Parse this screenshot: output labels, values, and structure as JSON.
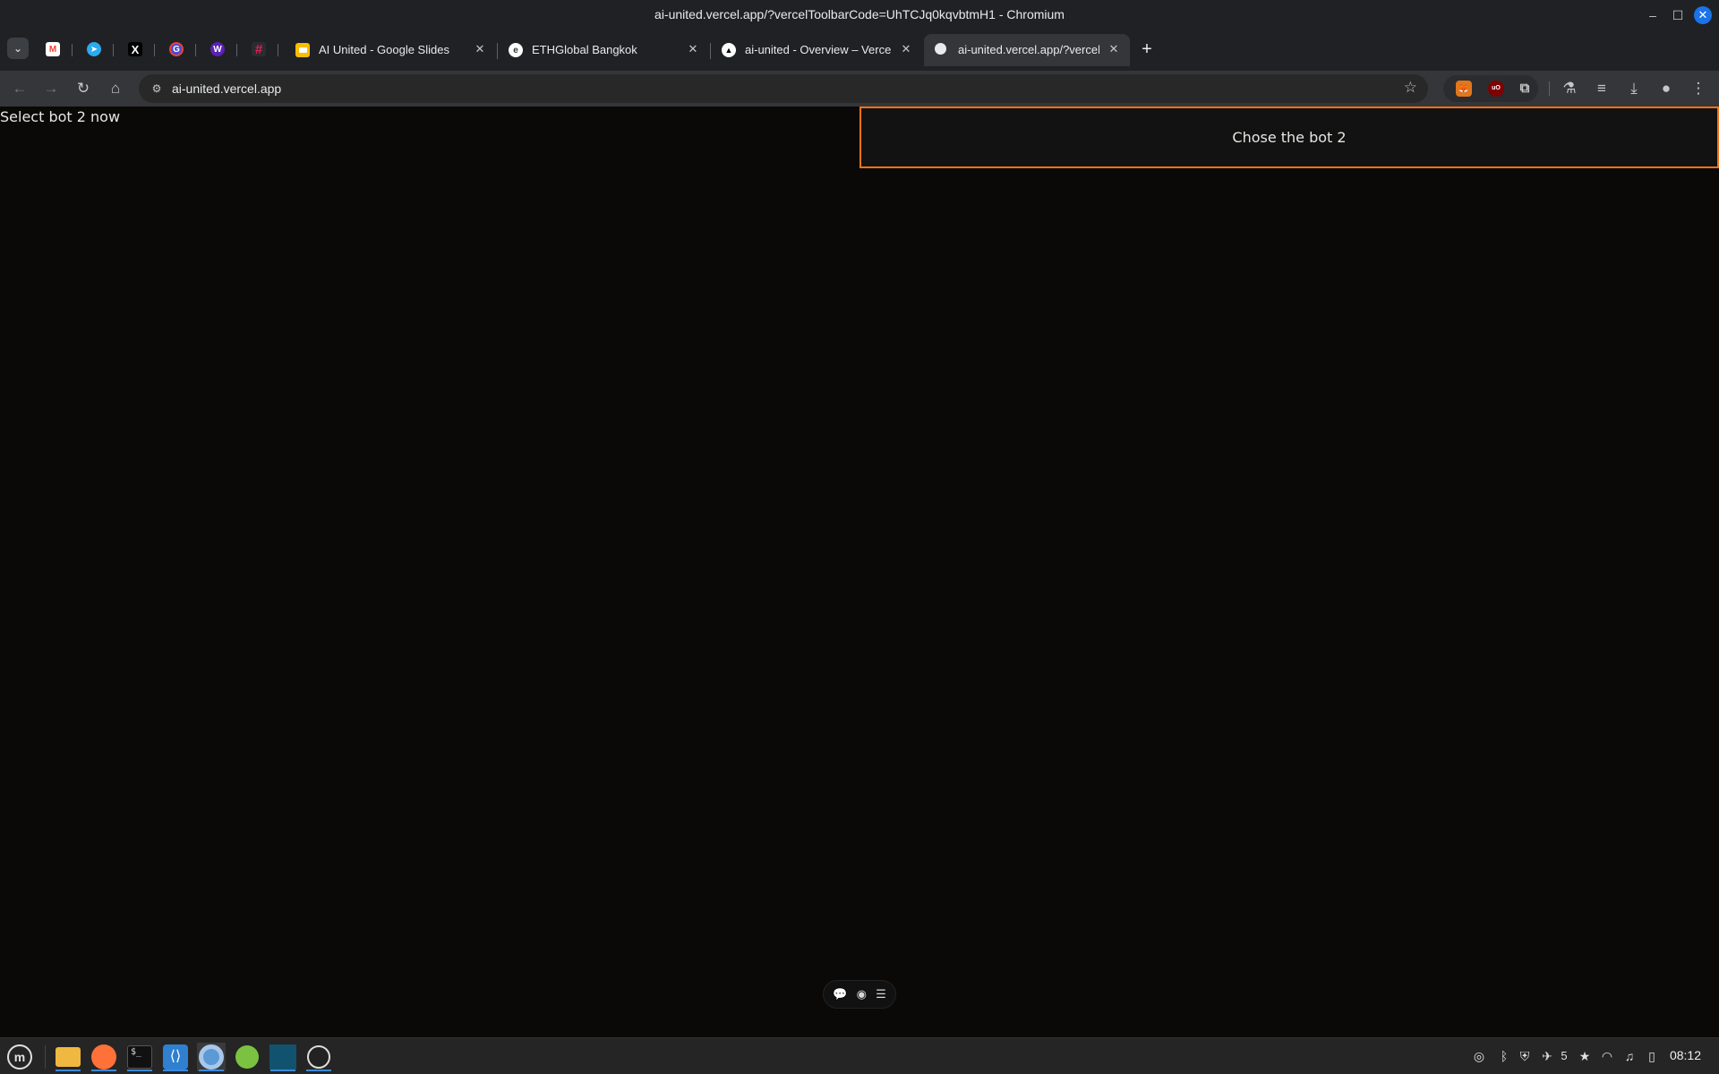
{
  "window": {
    "title": "ai-united.vercel.app/?vercelToolbarCode=UhTCJq0kqvbtmH1 - Chromium",
    "minimize_icon": "minimize-icon",
    "maximize_icon": "maximize-icon",
    "close_icon": "close-icon"
  },
  "pinned_tabs": [
    {
      "name": "gmail",
      "icon": "gmail-icon",
      "glyph": "M",
      "color": "#ea4335"
    },
    {
      "name": "telegram",
      "icon": "telegram-icon",
      "glyph": "➤",
      "color": "#2aabee"
    },
    {
      "name": "x",
      "icon": "x-icon",
      "glyph": "𝕏",
      "color": "#000000"
    },
    {
      "name": "app-red-badge",
      "icon": "red-badge-app-icon",
      "glyph": "G",
      "color": "#4a4ad6"
    },
    {
      "name": "w-app",
      "icon": "w-app-icon",
      "glyph": "W",
      "color": "#5b21b6"
    },
    {
      "name": "slack",
      "icon": "slack-icon",
      "glyph": "#",
      "color": "#e01e5a"
    }
  ],
  "tabs": [
    {
      "label": "AI United - Google Slides",
      "icon": "google-slides-icon",
      "color": "#fbbc04"
    },
    {
      "label": "ETHGlobal Bangkok",
      "icon": "ethglobal-icon",
      "color": "#ffffff"
    },
    {
      "label": "ai-united - Overview – Vercel",
      "icon": "vercel-icon",
      "color": "#000000"
    },
    {
      "label": "ai-united.vercel.app/?vercelT",
      "icon": "page-icon",
      "color": "#e8eaed"
    }
  ],
  "toolbar": {
    "url": "ai-united.vercel.app"
  },
  "page": {
    "message": "Select bot 2 now",
    "bot_button_label": "Chose the bot 2",
    "accent_color": "#f97316"
  },
  "taskbar": {
    "tray_count": "5",
    "clock": "08:12"
  }
}
